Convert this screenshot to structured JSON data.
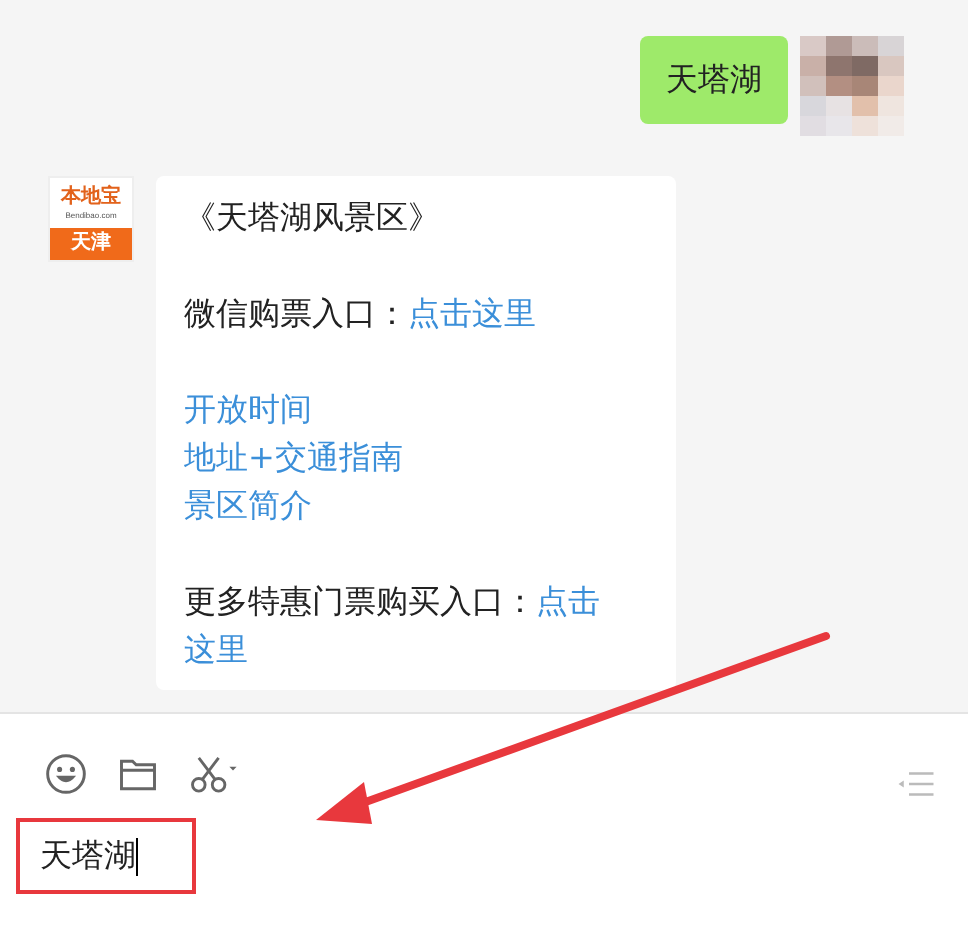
{
  "chat": {
    "messages": [
      {
        "kind": "sent",
        "text": "天塔湖"
      },
      {
        "kind": "received",
        "logo": {
          "brand": "本地宝",
          "site": "Bendibao.com",
          "city": "天津"
        },
        "paragraphs": [
          {
            "lines": [
              [
                {
                  "kind": "text",
                  "text": "《天塔湖风景区》"
                }
              ]
            ]
          },
          {
            "lines": [
              [
                {
                  "kind": "text",
                  "text": "微信购票入口："
                },
                {
                  "kind": "link",
                  "text": "点击这里"
                }
              ]
            ]
          },
          {
            "lines": [
              [
                {
                  "kind": "link",
                  "text": "开放时间"
                }
              ],
              [
                {
                  "kind": "link",
                  "text": "地址+交通指南"
                }
              ],
              [
                {
                  "kind": "link",
                  "text": "景区简介"
                }
              ]
            ]
          },
          {
            "lines": [
              [
                {
                  "kind": "text",
                  "text": "更多特惠门票购买入口："
                },
                {
                  "kind": "link",
                  "text": "点击"
                }
              ],
              [
                {
                  "kind": "link",
                  "text": "这里"
                }
              ]
            ]
          }
        ]
      }
    ]
  },
  "composer": {
    "value": "天塔湖"
  }
}
